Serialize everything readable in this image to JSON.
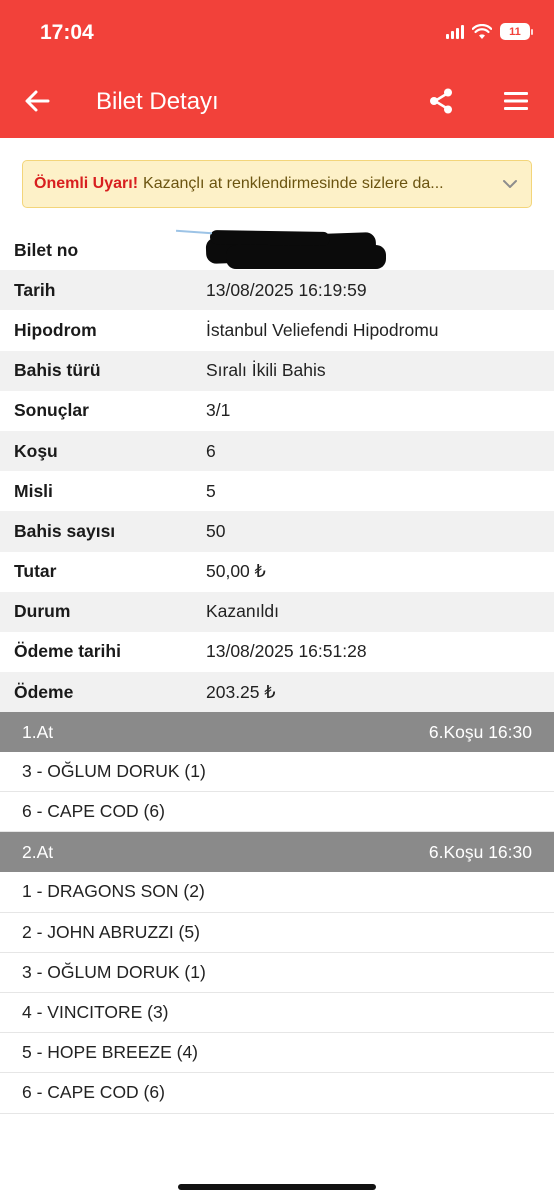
{
  "status_bar": {
    "time": "17:04",
    "battery": "11"
  },
  "header": {
    "title": "Bilet Detayı"
  },
  "alert": {
    "strong": "Önemli Uyarı!",
    "text": "Kazançlı at renklendirmesinde sizlere da..."
  },
  "details": [
    {
      "label": "Bilet no",
      "value": ""
    },
    {
      "label": "Tarih",
      "value": "13/08/2025 16:19:59"
    },
    {
      "label": "Hipodrom",
      "value": "İstanbul Veliefendi Hipodromu"
    },
    {
      "label": "Bahis türü",
      "value": "Sıralı İkili Bahis"
    },
    {
      "label": "Sonuçlar",
      "value": "3/1"
    },
    {
      "label": "Koşu",
      "value": "6"
    },
    {
      "label": "Misli",
      "value": "5"
    },
    {
      "label": "Bahis sayısı",
      "value": "50"
    },
    {
      "label": "Tutar",
      "value": "50,00 ₺"
    },
    {
      "label": "Durum",
      "value": "Kazanıldı"
    },
    {
      "label": "Ödeme tarihi",
      "value": "13/08/2025 16:51:28"
    },
    {
      "label": "Ödeme",
      "value": "203.25 ₺"
    }
  ],
  "sections": [
    {
      "title": "1.At",
      "race": "6.Koşu 16:30",
      "horses": [
        "3 - OĞLUM DORUK (1)",
        "6 - CAPE COD (6)"
      ]
    },
    {
      "title": "2.At",
      "race": "6.Koşu 16:30",
      "horses": [
        "1 - DRAGONS SON (2)",
        "2 - JOHN ABRUZZI (5)",
        "3 - OĞLUM DORUK (1)",
        "4 - VINCITORE (3)",
        "5 - HOPE BREEZE (4)",
        "6 - CAPE COD (6)"
      ]
    }
  ],
  "icons": {
    "back": "arrow-left-icon",
    "share": "share-icon",
    "menu": "hamburger-menu-icon",
    "expand": "chevron-down-icon"
  },
  "colors": {
    "header": "#f2413a",
    "alert_bg": "#fdf1c8",
    "alert_strong": "#d81f1f",
    "section_bg": "#8a8a8a"
  }
}
